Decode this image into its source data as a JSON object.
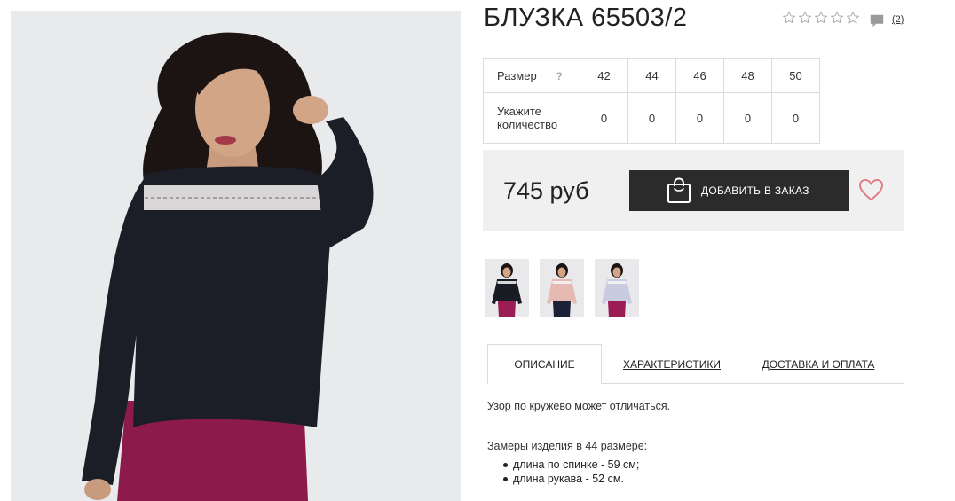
{
  "product": {
    "title": "БЛУЗКА 65503/2",
    "review_count": "(2)",
    "rating_stars": 5,
    "rating_value": 0
  },
  "size_table": {
    "size_label": "Размер",
    "help_label": "?",
    "qty_label": "Укажите количество",
    "sizes": [
      "42",
      "44",
      "46",
      "48",
      "50"
    ],
    "quantities": [
      "0",
      "0",
      "0",
      "0",
      "0"
    ]
  },
  "purchase": {
    "price": "745 руб",
    "add_button_label": "ДОБАВИТЬ В ЗАКАЗ"
  },
  "thumbnails": [
    {
      "name": "thumb-black",
      "blouse_color": "#1a1c24",
      "pants_color": "#9c1d55"
    },
    {
      "name": "thumb-pink",
      "blouse_color": "#e6b9b3",
      "pants_color": "#1c2235"
    },
    {
      "name": "thumb-lavender",
      "blouse_color": "#c9cbe0",
      "pants_color": "#9c1d55"
    }
  ],
  "tabs": [
    {
      "label": "ОПИСАНИЕ",
      "active": true
    },
    {
      "label": "ХАРАКТЕРИСТИКИ",
      "active": false
    },
    {
      "label": "ДОСТАВКА И ОПЛАТА",
      "active": false
    }
  ],
  "description": {
    "note": "Узор по кружево может отличаться.",
    "measure_title": "Замеры изделия в 44 размере:",
    "measures": [
      "длина по спинке - 59 см;",
      "длина рукава - 52 см."
    ]
  },
  "colors": {
    "button_bg": "#2b2b2b",
    "price_block_bg": "#f0f0f0",
    "heart": "#e07b84",
    "border": "#dcdcdc"
  },
  "icons": [
    "star-icon",
    "comment-icon",
    "help-icon",
    "bag-icon",
    "heart-icon"
  ]
}
